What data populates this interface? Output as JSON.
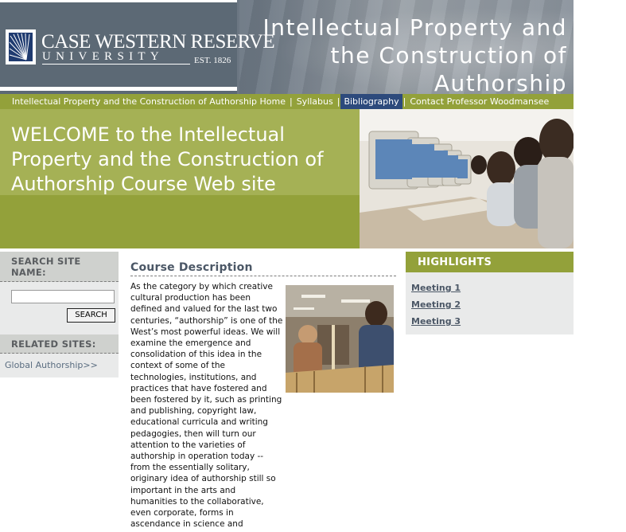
{
  "header": {
    "university_name": "CASE WESTERN RESERVE",
    "university_sub": "UNIVERSITY",
    "established": "EST. 1826",
    "site_title": "Intellectual Property and the Construction of Authorship"
  },
  "nav": {
    "items": [
      {
        "label": "Intellectual Property and the Construction of Authorship Home",
        "active": false
      },
      {
        "label": "Syllabus",
        "active": false
      },
      {
        "label": "Bibliography",
        "active": true
      },
      {
        "label": "Contact Professor Woodmansee",
        "active": false
      }
    ],
    "separator": "|"
  },
  "banner": {
    "welcome": "WELCOME to the Intellectual Property and the Construction of Authorship Course Web site"
  },
  "sidebar": {
    "search_heading": "SEARCH SITE NAME:",
    "search_value": "",
    "search_button": "SEARCH",
    "related_heading": "RELATED SITES:",
    "related_link": "Global Authorship>>"
  },
  "main": {
    "heading": "Course Description",
    "description": "As the category by which creative cultural production has been defined and valued for the last two centuries, “authorship” is one of the West’s most powerful ideas. We will examine the emergence and consolidation of this idea in the context of some of the technologies, institutions, and practices that have fostered and been fostered by it, such as printing and publishing, copyright law, educational curricula and writing pedagogies, then will turn our attention to the varieties of authorship in operation today -- from the essentially solitary, originary idea of authorship still so important in the arts and humanities to the collaborative, even corporate, forms in ascendance in science and"
  },
  "highlights": {
    "heading": "HIGHLIGHTS",
    "links": [
      "Meeting 1",
      "Meeting 2",
      "Meeting 3"
    ]
  },
  "colors": {
    "olive": "#93a13a",
    "olive_light": "#a5b155",
    "header_slate": "#5f6b78",
    "nav_active": "#2d4a7c",
    "sidebar_gray": "#e9eaea",
    "heading_text": "#4b5766"
  },
  "icons": {
    "seal": "university-seal-icon"
  }
}
